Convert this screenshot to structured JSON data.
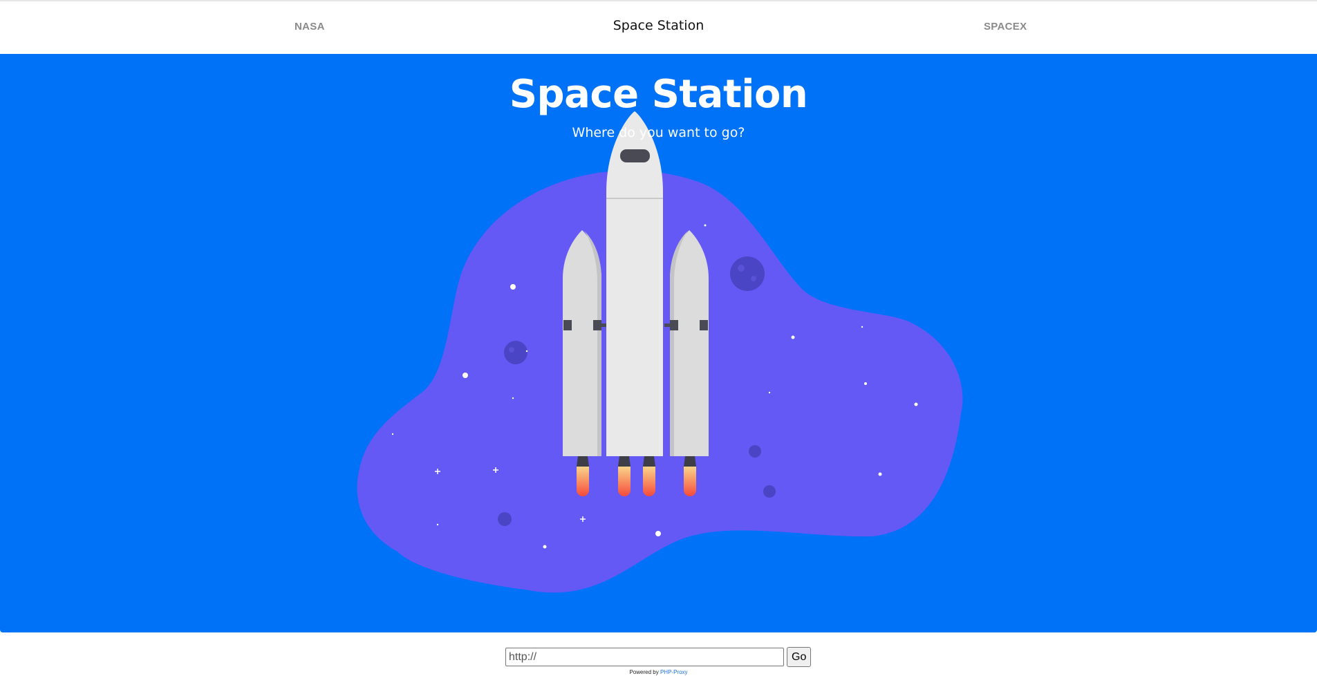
{
  "navbar": {
    "left_link": "NASA",
    "brand": "Space Station",
    "right_link": "SPACEX"
  },
  "hero": {
    "title": "Space Station",
    "subtitle": "Where do you want to go?"
  },
  "proxy_form": {
    "url_value": "http://",
    "go_label": "Go"
  },
  "footer": {
    "powered_by_text": "Powered by",
    "powered_by_link": "PHP-Proxy"
  },
  "colors": {
    "hero_background": "#0072f8",
    "blob": "#6559f5",
    "rocket_body": "#e9e9ea",
    "flame_top": "#f9d48a",
    "flame_bottom": "#f64a3b"
  }
}
